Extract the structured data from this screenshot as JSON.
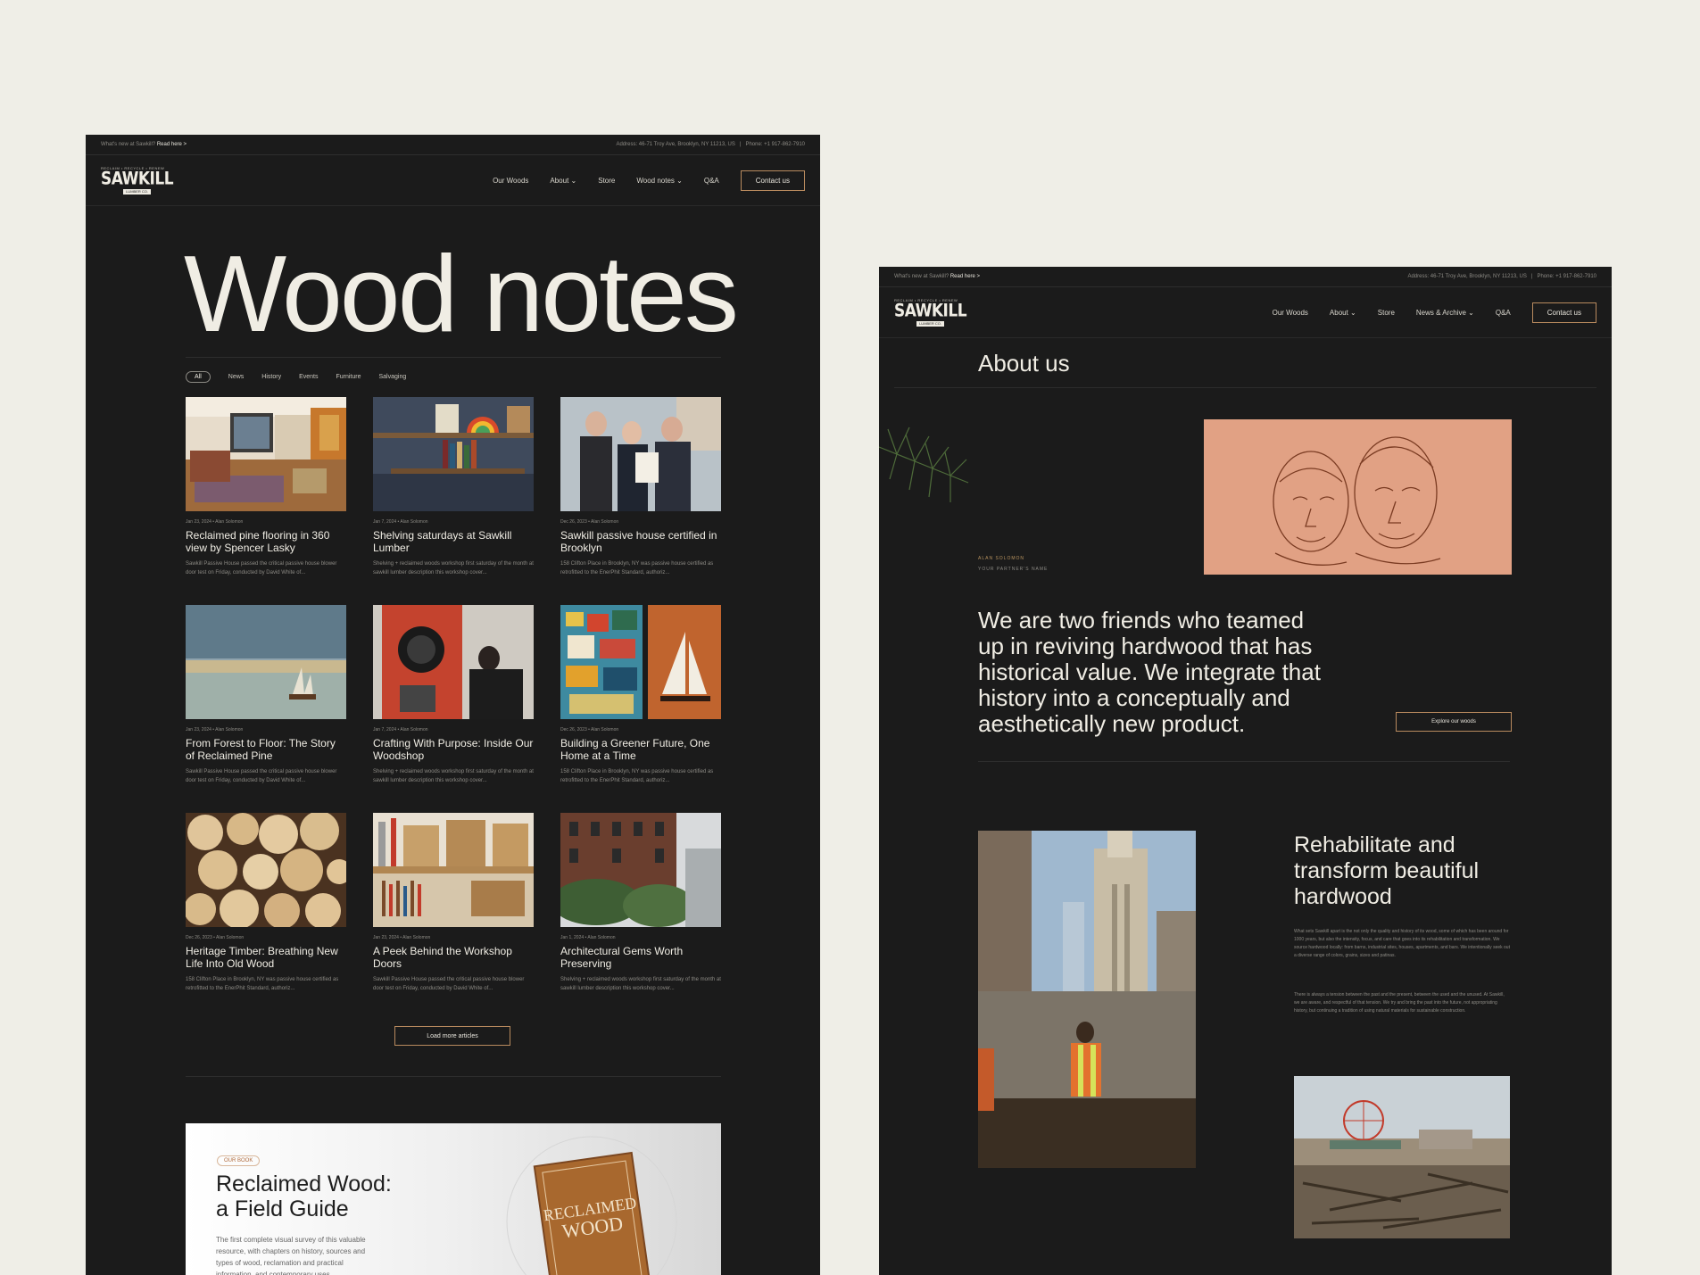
{
  "left": {
    "topbar": {
      "whats_new": "What's new at Sawkill?",
      "read_here": "Read here >",
      "address": "Address: 46-71 Troy Ave, Brooklyn, NY 11213, US",
      "separator": "|",
      "phone": "Phone: +1 917-862-7910"
    },
    "logo": {
      "tagline": "RECLAIM • RECYCLE • RENEW",
      "name": "SAWKILL",
      "sub": "LUMBER CO."
    },
    "nav": [
      "Our Woods",
      "About ⌄",
      "Store",
      "Wood notes ⌄",
      "Q&A"
    ],
    "contact": "Contact us",
    "title": "Wood notes",
    "filters": [
      "All",
      "News",
      "History",
      "Events",
      "Furniture",
      "Salvaging"
    ],
    "cards": [
      {
        "meta": "Jan 23, 2024  •  Alan Solomon",
        "title": "Reclaimed pine flooring in 360 view by  Spencer Lasky",
        "desc": "Sawkill Passive House passed the critical passive house blower door test on Friday, conducted by David White of..."
      },
      {
        "meta": "Jan 7, 2024  •  Alan Solomon",
        "title": "Shelving saturdays at Sawkill Lumber",
        "desc": "Shelving + reclaimed woods workshop first saturday of the month at sawkill lumber  description this workshop cover..."
      },
      {
        "meta": "Dec 26, 2023  •  Alan Solomon",
        "title": "Sawkill passive house certified in Brooklyn",
        "desc": "158 Clifton Place in Brooklyn, NY was passive house certified as retrofitted to the EnerPhit Standard, authoriz..."
      },
      {
        "meta": "Jan 23, 2024  •  Alan Solomon",
        "title": "From Forest to Floor: The Story of Reclaimed Pine",
        "desc": "Sawkill Passive House passed the critical passive house blower door test on Friday, conducted by David White of..."
      },
      {
        "meta": "Jan 7, 2024  •  Alan Solomon",
        "title": "Crafting With Purpose: Inside Our Woodshop",
        "desc": "Shelving + reclaimed woods workshop first saturday of the month at sawkill lumber  description this workshop cover..."
      },
      {
        "meta": "Dec 26, 2023  •  Alan Solomon",
        "title": "Building a Greener Future, One Home at a Time",
        "desc": "158 Clifton Place in Brooklyn, NY was passive house certified as retrofitted to the EnerPhit Standard, authoriz..."
      },
      {
        "meta": "Dec 26, 2023  •  Alan Solomon",
        "title": "Heritage Timber: Breathing New Life Into Old Wood",
        "desc": "158 Clifton Place in Brooklyn, NY was passive house certified as retrofitted to the EnerPhit Standard, authoriz..."
      },
      {
        "meta": "Jan 23, 2024  •  Alan Solomon",
        "title": "A Peek Behind the Workshop Doors",
        "desc": "Sawkill Passive House passed the critical passive house blower door test on Friday, conducted by David White of..."
      },
      {
        "meta": "Jan 1, 2024  •  Alan Solomon",
        "title": "Architectural Gems Worth Preserving",
        "desc": "Shelving + reclaimed woods workshop first saturday of the month at sawkill lumber  description this workshop cover..."
      }
    ],
    "load_more": "Load more articles",
    "book": {
      "badge": "OUR BOOK",
      "title_line1": "Reclaimed Wood:",
      "title_line2": "a Field Guide",
      "desc": "The first complete visual survey of this valuable resource, with chapters on history, sources and types of wood, reclamation and practical information, and contemporary uses",
      "cover_line1": "RECLAIMED",
      "cover_line2": "WOOD"
    }
  },
  "right": {
    "topbar": {
      "whats_new": "What's new at Sawkill?",
      "read_here": "Read here >",
      "address": "Address: 46-71 Troy Ave, Brooklyn, NY 11213, US",
      "separator": "|",
      "phone": "Phone: +1 917-862-7910"
    },
    "logo": {
      "tagline": "RECLAIM • RECYCLE • RENEW",
      "name": "SAWKILL",
      "sub": "LUMBER CO."
    },
    "nav": [
      "Our Woods",
      "About ⌄",
      "Store",
      "News & Archive ⌄",
      "Q&A"
    ],
    "contact": "Contact us",
    "title": "About us",
    "person_name": "ALAN SOLOMON",
    "person_role": "YOUR PARTNER'S NAME",
    "lead": "We are two friends who teamed up in reviving hardwood that has historical value. We integrate that history into a conceptually and aesthetically new product.",
    "explore": "Explore our woods",
    "section_title": "Rehabilitate and transform beautiful hardwood",
    "para1": "What sets Sawkill apart is the not only the quality and history of its wood, some of which has been around for 1000 years, but also the intensity, focus, and care that goes into its rehabilitation and transformation. We source hardwood locally: from barns, industrial sites, houses, apartments, and bars. We intentionally seek out a diverse range of colors, grains, sizes and patinas.",
    "para2": "There is always a tension between the past and the present, between the used and the unused. At Sawkill, we are aware, and respectful of that tension. We try and bring the past into the future, not appropriating history, but continuing a tradition of using natural materials for sustainable construction."
  }
}
